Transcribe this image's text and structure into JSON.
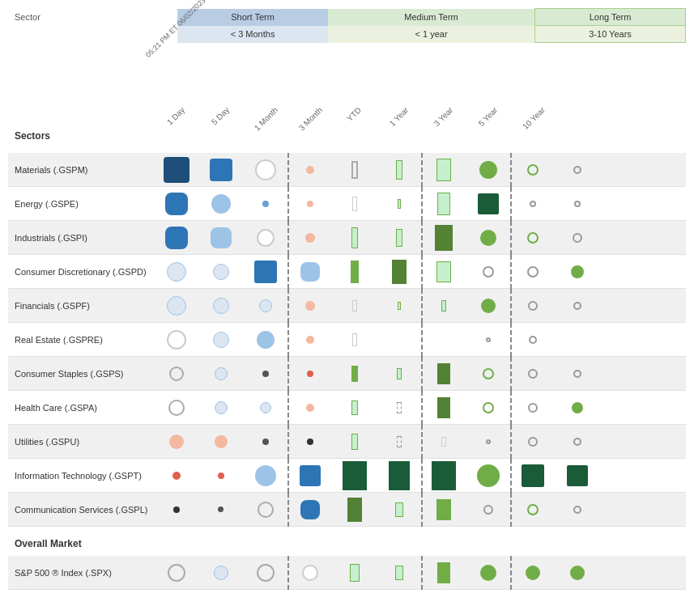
{
  "header": {
    "sector_label": "Sector",
    "short_term_label": "Short Term",
    "short_term_sub": "< 3 Months",
    "medium_term_label": "Medium Term",
    "medium_term_sub": "< 1 year",
    "long_term_label": "Long Term",
    "long_term_sub": "3-10 Years"
  },
  "col_headers": {
    "timestamp": "05:21 PM ET 06/02/2023",
    "cols": [
      "1 Day",
      "5 Day",
      "1 Month",
      "3 Month",
      "YTD",
      "1 Year",
      "3 Year",
      "5 Year",
      "10 Year"
    ]
  },
  "sections_label": "Sectors",
  "rows": [
    {
      "label": "Materials (.GSPM)"
    },
    {
      "label": "Energy (.GSPE)"
    },
    {
      "label": "Industrials (.GSPI)"
    },
    {
      "label": "Consumer Discretionary (.GSPD)"
    },
    {
      "label": "Financials (.GSPF)"
    },
    {
      "label": "Real Estate (.GSPRE)"
    },
    {
      "label": "Consumer Staples (.GSPS)"
    },
    {
      "label": "Health Care (.GSPA)"
    },
    {
      "label": "Utilities (.GSPU)"
    },
    {
      "label": "Information Technology (.GSPT)"
    },
    {
      "label": "Communication Services (.GSPL)"
    }
  ],
  "overall_label": "Overall Market",
  "spx_label": "S&P 500 ® Index (.SPX)"
}
